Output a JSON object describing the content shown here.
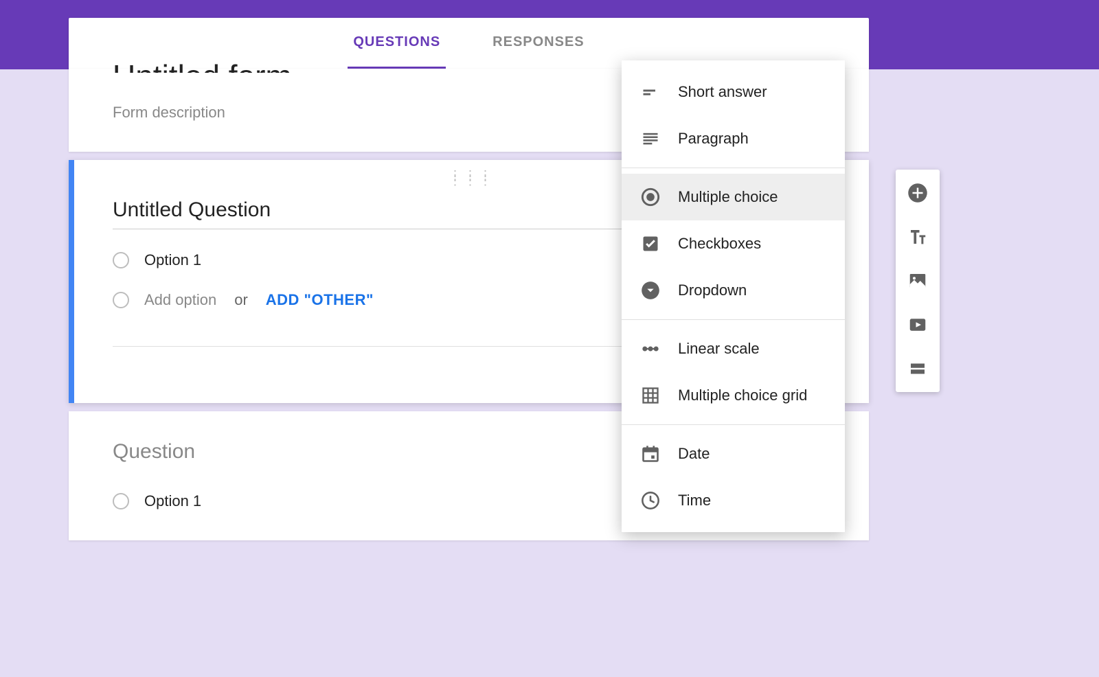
{
  "tabs": {
    "questions": "QUESTIONS",
    "responses": "RESPONSES"
  },
  "header": {
    "title": "Untitled form",
    "description_placeholder": "Form description"
  },
  "question1": {
    "title": "Untitled Question",
    "option1": "Option 1",
    "add_option_placeholder": "Add option",
    "or": "or",
    "add_other": "ADD \"OTHER\""
  },
  "question2": {
    "title": "Question",
    "option1": "Option 1"
  },
  "type_menu": {
    "short_answer": "Short answer",
    "paragraph": "Paragraph",
    "multiple_choice": "Multiple choice",
    "checkboxes": "Checkboxes",
    "dropdown": "Dropdown",
    "linear_scale": "Linear scale",
    "mc_grid": "Multiple choice grid",
    "date": "Date",
    "time": "Time"
  }
}
